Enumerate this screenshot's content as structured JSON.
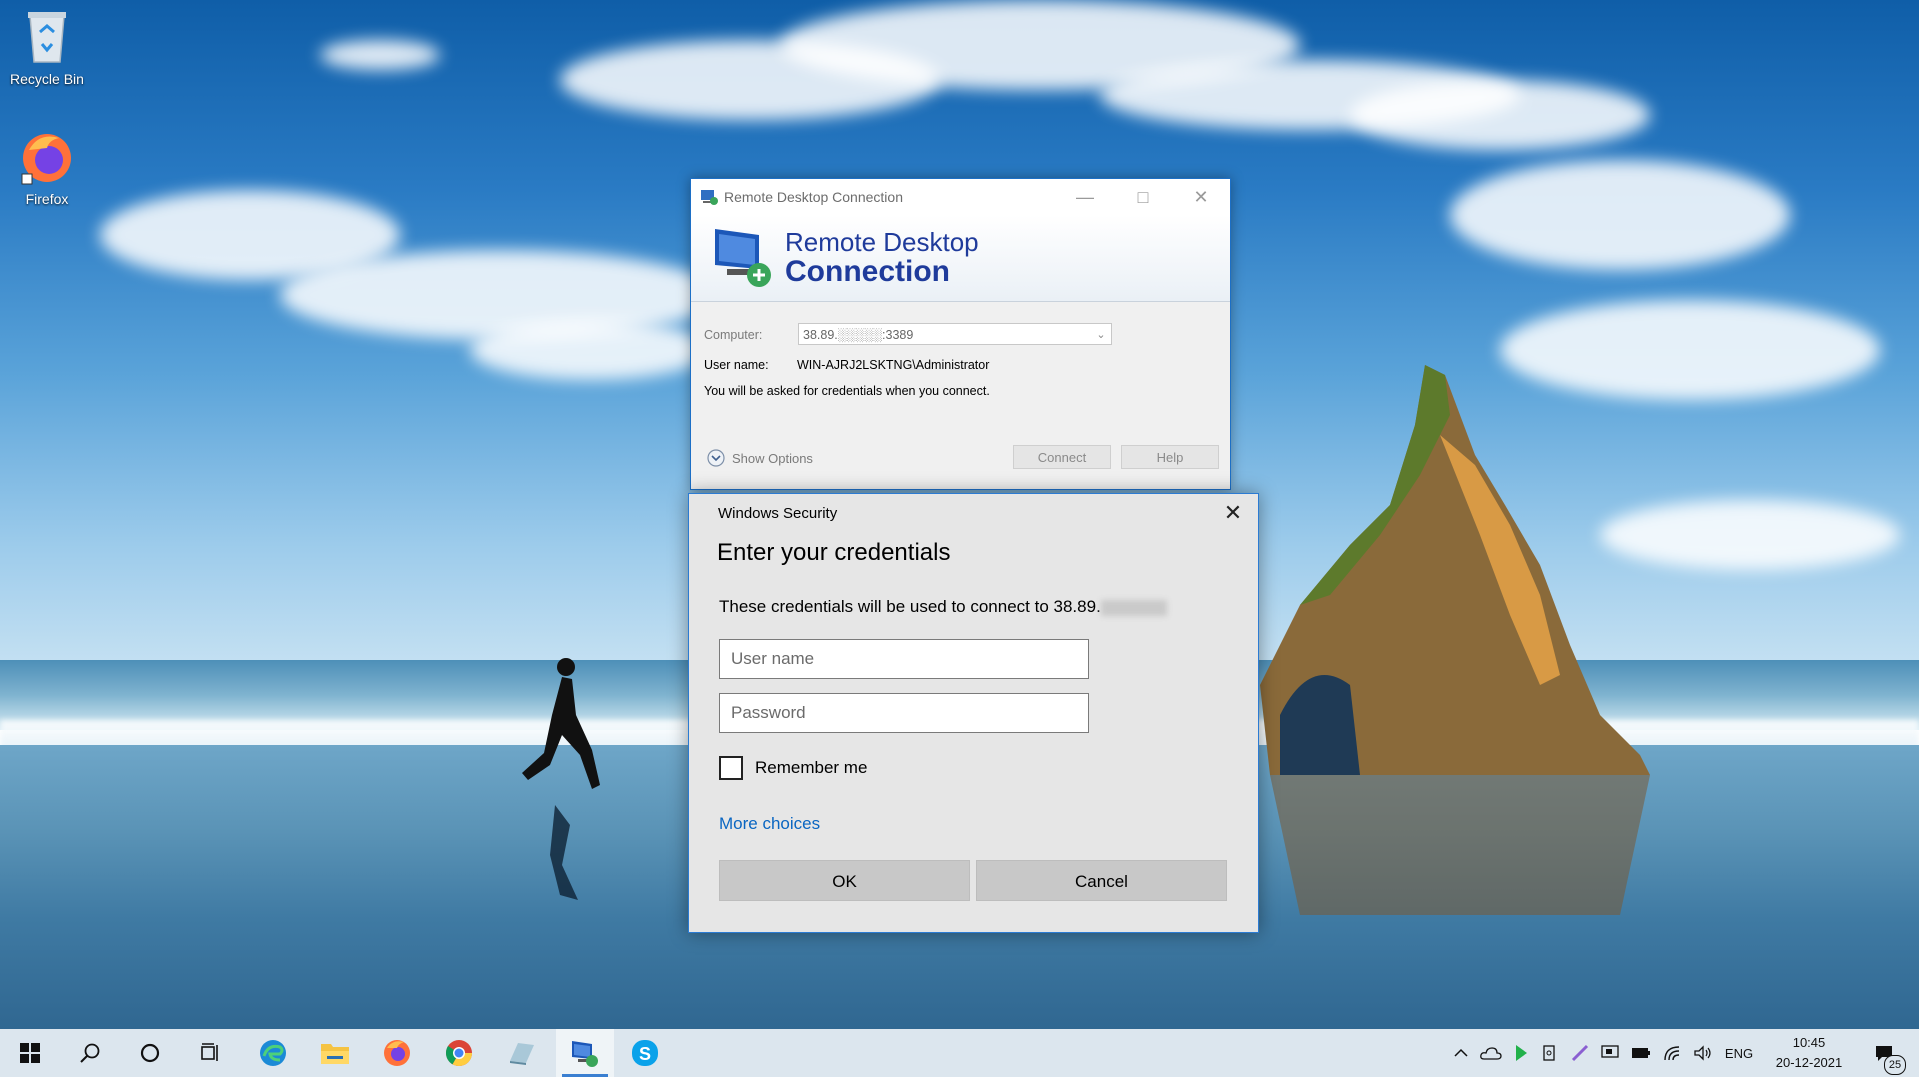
{
  "desktop": {
    "icons": [
      {
        "label": "Recycle Bin"
      },
      {
        "label": "Firefox"
      }
    ]
  },
  "rdc": {
    "title": "Remote Desktop Connection",
    "banner_line1": "Remote Desktop",
    "banner_line2": "Connection",
    "computer_label": "Computer:",
    "computer_value": "38.89.░░░░░:3389",
    "username_label": "User name:",
    "username_value": "WIN-AJRJ2LSKTNG\\Administrator",
    "info_text": "You will be asked for credentials when you connect.",
    "show_options": "Show Options",
    "connect": "Connect",
    "help": "Help"
  },
  "security": {
    "header": "Windows Security",
    "heading": "Enter your credentials",
    "description": "These credentials will be used to connect to 38.89.",
    "username_placeholder": "User name",
    "password_placeholder": "Password",
    "remember_me": "Remember me",
    "more_choices": "More choices",
    "ok": "OK",
    "cancel": "Cancel"
  },
  "taskbar": {
    "language": "ENG",
    "time": "10:45",
    "date": "20-12-2021",
    "notification_count": "25"
  },
  "colors": {
    "accent": "#2b7bd3",
    "link": "#0a66c2",
    "banner_text": "#1f3b9b"
  }
}
